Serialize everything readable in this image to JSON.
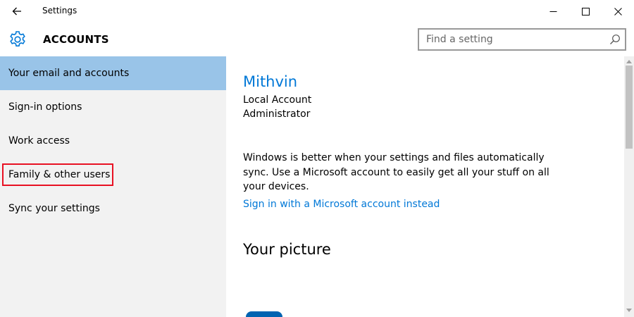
{
  "window": {
    "title": "Settings"
  },
  "header": {
    "title": "ACCOUNTS",
    "search_placeholder": "Find a setting"
  },
  "sidebar": {
    "items": [
      {
        "label": "Your email and accounts",
        "selected": true
      },
      {
        "label": "Sign-in options",
        "selected": false
      },
      {
        "label": "Work access",
        "selected": false
      },
      {
        "label": "Family & other users",
        "selected": false,
        "highlighted": true
      },
      {
        "label": "Sync your settings",
        "selected": false
      }
    ]
  },
  "main": {
    "user_name": "Mithvin",
    "account_type": "Local Account",
    "account_role": "Administrator",
    "sync_message": "Windows is better when your settings and files automatically sync. Use a Microsoft account to easily get all your stuff on all your devices.",
    "signin_link": "Sign in with a Microsoft account instead",
    "picture_heading": "Your picture"
  },
  "colors": {
    "accent": "#0078d7",
    "selected_nav": "#99c4e8",
    "highlight_border": "#e81123",
    "sidebar_bg": "#f2f2f2"
  }
}
